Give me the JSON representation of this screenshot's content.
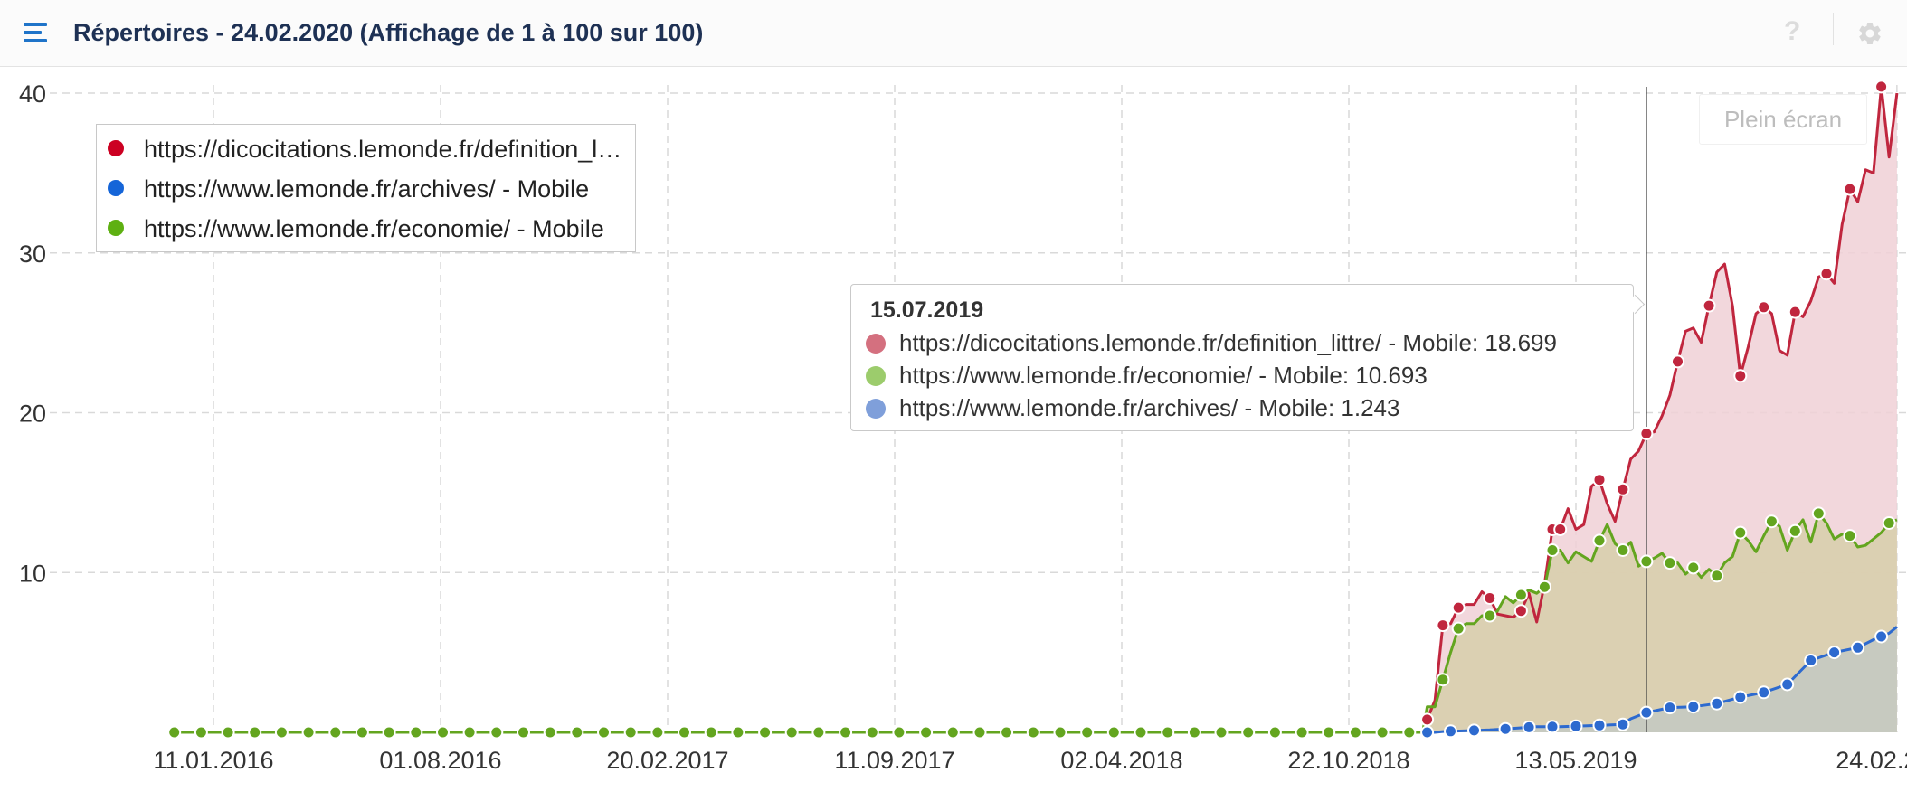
{
  "header": {
    "title": "Répertoires - 24.02.2020 (Affichage de 1 à 100 sur 100)",
    "menu_icon": "hamburger-menu-icon",
    "help_label": "?",
    "help_icon": "question-icon",
    "settings_icon": "gear-icon"
  },
  "fullscreen_label": "Plein écran",
  "colors": {
    "accent": "#1f74c9",
    "series_red": "#c0263e",
    "series_green": "#63a51f",
    "series_blue": "#2d6acf",
    "gridline": "#d9d9d9"
  },
  "legend": {
    "items": [
      {
        "label": "https://dicocitations.lemonde.fr/definition_littre/ - Mobile",
        "color": "#cc0022"
      },
      {
        "label": "https://www.lemonde.fr/archives/ - Mobile",
        "color": "#1565d8"
      },
      {
        "label": "https://www.lemonde.fr/economie/ - Mobile",
        "color": "#5eb012"
      }
    ]
  },
  "tooltip": {
    "date": "15.07.2019",
    "rows": [
      {
        "text": "https://dicocitations.lemonde.fr/definition_littre/ - Mobile: 18.699",
        "color": "#d4707f"
      },
      {
        "text": "https://www.lemonde.fr/economie/ - Mobile: 10.693",
        "color": "#9ccc6c"
      },
      {
        "text": "https://www.lemonde.fr/archives/ - Mobile: 1.243",
        "color": "#7f9fda"
      }
    ]
  },
  "chart_data": {
    "type": "area",
    "title": "",
    "xlabel": "",
    "ylabel": "",
    "ylim": [
      0,
      40
    ],
    "yticks": [
      "10",
      "20",
      "30",
      "40"
    ],
    "x_tick_labels": [
      "11.01.2016",
      "01.08.2016",
      "20.02.2017",
      "11.09.2017",
      "02.04.2018",
      "22.10.2018",
      "13.05.2019",
      "24.02.2020"
    ],
    "grid": true,
    "legend_position": "top-left",
    "crosshair_date": "15.07.2019",
    "series": [
      {
        "name": "https://dicocitations.lemonde.fr/definition_littre/ - Mobile",
        "color": "#c0263e",
        "fill": "#f0d0d6",
        "points": [
          [
            "27.12.2018",
            0.0
          ],
          [
            "31.12.2018",
            0.8
          ],
          [
            "07.01.2019",
            2.0
          ],
          [
            "14.01.2019",
            6.7
          ],
          [
            "21.01.2019",
            6.8
          ],
          [
            "28.01.2019",
            7.8
          ],
          [
            "04.02.2019",
            8.0
          ],
          [
            "11.02.2019",
            8.0
          ],
          [
            "18.02.2019",
            8.8
          ],
          [
            "25.02.2019",
            8.4
          ],
          [
            "04.03.2019",
            7.4
          ],
          [
            "11.03.2019",
            7.3
          ],
          [
            "18.03.2019",
            7.2
          ],
          [
            "25.03.2019",
            7.6
          ],
          [
            "01.04.2019",
            8.7
          ],
          [
            "08.04.2019",
            6.9
          ],
          [
            "15.04.2019",
            9.3
          ],
          [
            "22.04.2019",
            12.7
          ],
          [
            "29.04.2019",
            12.7
          ],
          [
            "06.05.2019",
            14.0
          ],
          [
            "13.05.2019",
            12.7
          ],
          [
            "20.05.2019",
            13.0
          ],
          [
            "27.05.2019",
            15.4
          ],
          [
            "03.06.2019",
            15.8
          ],
          [
            "10.06.2019",
            14.3
          ],
          [
            "17.06.2019",
            13.2
          ],
          [
            "24.06.2019",
            15.2
          ],
          [
            "01.07.2019",
            17.1
          ],
          [
            "08.07.2019",
            17.6
          ],
          [
            "15.07.2019",
            18.7
          ],
          [
            "22.07.2019",
            18.8
          ],
          [
            "29.07.2019",
            19.8
          ],
          [
            "05.08.2019",
            21.1
          ],
          [
            "12.08.2019",
            23.2
          ],
          [
            "19.08.2019",
            25.1
          ],
          [
            "26.08.2019",
            25.3
          ],
          [
            "02.09.2019",
            24.4
          ],
          [
            "09.09.2019",
            26.7
          ],
          [
            "16.09.2019",
            28.8
          ],
          [
            "23.09.2019",
            29.3
          ],
          [
            "30.09.2019",
            26.7
          ],
          [
            "07.10.2019",
            22.3
          ],
          [
            "14.10.2019",
            24.1
          ],
          [
            "21.10.2019",
            26.2
          ],
          [
            "28.10.2019",
            26.6
          ],
          [
            "04.11.2019",
            26.2
          ],
          [
            "11.11.2019",
            23.9
          ],
          [
            "18.11.2019",
            23.6
          ],
          [
            "25.11.2019",
            26.3
          ],
          [
            "02.12.2019",
            26.0
          ],
          [
            "09.12.2019",
            27.0
          ],
          [
            "16.12.2019",
            28.5
          ],
          [
            "23.12.2019",
            28.7
          ],
          [
            "30.12.2019",
            28.1
          ],
          [
            "06.01.2020",
            31.8
          ],
          [
            "13.01.2020",
            34.0
          ],
          [
            "20.01.2020",
            33.2
          ],
          [
            "27.01.2020",
            35.2
          ],
          [
            "03.02.2020",
            35.0
          ],
          [
            "10.02.2020",
            40.4
          ],
          [
            "17.02.2020",
            36.0
          ],
          [
            "24.02.2020",
            40.0
          ]
        ],
        "markers": [
          "31.12.2018",
          "14.01.2019",
          "28.01.2019",
          "25.02.2019",
          "25.03.2019",
          "22.04.2019",
          "29.04.2019",
          "03.06.2019",
          "24.06.2019",
          "15.07.2019",
          "12.08.2019",
          "09.09.2019",
          "07.10.2019",
          "28.10.2019",
          "25.11.2019",
          "23.12.2019",
          "13.01.2020",
          "10.02.2020"
        ]
      },
      {
        "name": "https://www.lemonde.fr/economie/ - Mobile",
        "color": "#63a51f",
        "fill": "#d7cfaa",
        "points": [
          [
            "07.12.2015",
            0.0
          ],
          [
            "27.12.2018",
            0.0
          ],
          [
            "31.12.2018",
            1.6
          ],
          [
            "07.01.2019",
            1.6
          ],
          [
            "14.01.2019",
            3.3
          ],
          [
            "21.01.2019",
            5.0
          ],
          [
            "28.01.2019",
            6.5
          ],
          [
            "04.02.2019",
            6.8
          ],
          [
            "11.02.2019",
            6.8
          ],
          [
            "18.02.2019",
            7.3
          ],
          [
            "25.02.2019",
            7.3
          ],
          [
            "04.03.2019",
            7.6
          ],
          [
            "11.03.2019",
            8.5
          ],
          [
            "18.03.2019",
            8.1
          ],
          [
            "25.03.2019",
            8.6
          ],
          [
            "01.04.2019",
            8.9
          ],
          [
            "08.04.2019",
            8.7
          ],
          [
            "15.04.2019",
            9.1
          ],
          [
            "22.04.2019",
            11.4
          ],
          [
            "29.04.2019",
            11.4
          ],
          [
            "06.05.2019",
            10.6
          ],
          [
            "13.05.2019",
            11.3
          ],
          [
            "20.05.2019",
            11.0
          ],
          [
            "27.05.2019",
            10.7
          ],
          [
            "03.06.2019",
            12.0
          ],
          [
            "10.06.2019",
            13.0
          ],
          [
            "17.06.2019",
            11.8
          ],
          [
            "24.06.2019",
            11.4
          ],
          [
            "01.07.2019",
            11.9
          ],
          [
            "08.07.2019",
            10.4
          ],
          [
            "15.07.2019",
            10.7
          ],
          [
            "22.07.2019",
            10.9
          ],
          [
            "29.07.2019",
            11.2
          ],
          [
            "05.08.2019",
            10.6
          ],
          [
            "12.08.2019",
            10.6
          ],
          [
            "19.08.2019",
            9.9
          ],
          [
            "26.08.2019",
            10.3
          ],
          [
            "02.09.2019",
            9.7
          ],
          [
            "09.09.2019",
            10.2
          ],
          [
            "16.09.2019",
            9.8
          ],
          [
            "23.09.2019",
            10.6
          ],
          [
            "30.09.2019",
            11.0
          ],
          [
            "07.10.2019",
            12.5
          ],
          [
            "14.10.2019",
            12.0
          ],
          [
            "21.10.2019",
            11.3
          ],
          [
            "28.10.2019",
            12.3
          ],
          [
            "04.11.2019",
            13.2
          ],
          [
            "11.11.2019",
            12.9
          ],
          [
            "18.11.2019",
            11.4
          ],
          [
            "25.11.2019",
            12.6
          ],
          [
            "02.12.2019",
            13.3
          ],
          [
            "09.12.2019",
            11.9
          ],
          [
            "16.12.2019",
            13.7
          ],
          [
            "23.12.2019",
            13.1
          ],
          [
            "30.12.2019",
            12.1
          ],
          [
            "06.01.2020",
            12.4
          ],
          [
            "13.01.2020",
            12.3
          ],
          [
            "20.01.2020",
            11.6
          ],
          [
            "27.01.2020",
            11.7
          ],
          [
            "03.02.2020",
            12.1
          ],
          [
            "10.02.2020",
            12.5
          ],
          [
            "17.02.2020",
            13.1
          ],
          [
            "24.02.2020",
            13.3
          ]
        ],
        "marker_start": "07.12.2015",
        "marker_step_days": 24,
        "marker_until": "27.12.2018",
        "markers": [
          "14.01.2019",
          "28.01.2019",
          "25.02.2019",
          "25.03.2019",
          "15.04.2019",
          "22.04.2019",
          "03.06.2019",
          "24.06.2019",
          "15.07.2019",
          "05.08.2019",
          "26.08.2019",
          "16.09.2019",
          "07.10.2019",
          "04.11.2019",
          "25.11.2019",
          "16.12.2019",
          "13.01.2020",
          "17.02.2020"
        ]
      },
      {
        "name": "https://www.lemonde.fr/archives/ - Mobile",
        "color": "#2d6acf",
        "fill": "#c3c9c2",
        "points": [
          [
            "27.12.2018",
            0.0
          ],
          [
            "07.01.2019",
            0.0
          ],
          [
            "14.01.2019",
            0.05
          ],
          [
            "04.02.2019",
            0.1
          ],
          [
            "25.02.2019",
            0.15
          ],
          [
            "18.03.2019",
            0.25
          ],
          [
            "08.04.2019",
            0.35
          ],
          [
            "29.04.2019",
            0.35
          ],
          [
            "20.05.2019",
            0.4
          ],
          [
            "10.06.2019",
            0.45
          ],
          [
            "24.06.2019",
            0.5
          ],
          [
            "01.07.2019",
            0.85
          ],
          [
            "15.07.2019",
            1.24
          ],
          [
            "05.08.2019",
            1.55
          ],
          [
            "26.08.2019",
            1.6
          ],
          [
            "16.09.2019",
            1.8
          ],
          [
            "07.10.2019",
            2.2
          ],
          [
            "28.10.2019",
            2.5
          ],
          [
            "18.11.2019",
            3.0
          ],
          [
            "09.12.2019",
            4.5
          ],
          [
            "30.12.2019",
            5.0
          ],
          [
            "20.01.2020",
            5.3
          ],
          [
            "03.02.2020",
            5.8
          ],
          [
            "17.02.2020",
            6.2
          ],
          [
            "24.02.2020",
            6.6
          ]
        ],
        "markers": [
          "31.12.2018",
          "21.01.2019",
          "11.02.2019",
          "11.03.2019",
          "01.04.2019",
          "22.04.2019",
          "13.05.2019",
          "03.06.2019",
          "24.06.2019",
          "15.07.2019",
          "05.08.2019",
          "26.08.2019",
          "16.09.2019",
          "07.10.2019",
          "28.10.2019",
          "18.11.2019",
          "09.12.2019",
          "30.12.2019",
          "20.01.2020",
          "10.02.2020"
        ]
      }
    ]
  }
}
